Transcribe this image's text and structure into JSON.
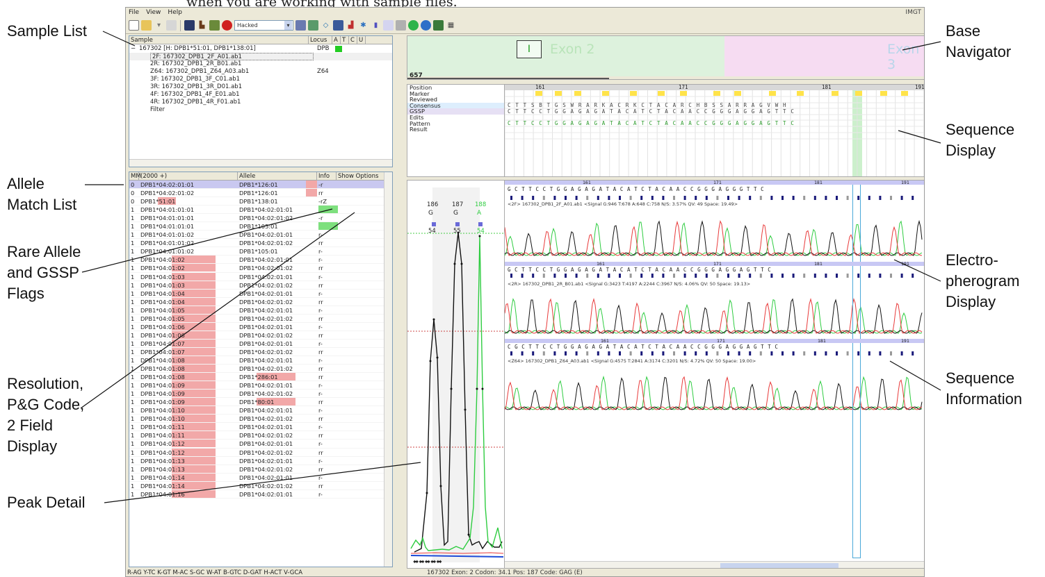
{
  "caption_top": "when you are working with sample files.",
  "callouts": {
    "sample_list": [
      "Sample List"
    ],
    "allele_match": [
      "Allele",
      "Match List"
    ],
    "rare_allele": [
      "Rare Allele",
      "and GSSP",
      "Flags"
    ],
    "resolution": [
      "Resolution,",
      "P&G Code,",
      "2 Field",
      "Display"
    ],
    "peak_detail": [
      "Peak Detail"
    ],
    "base_navigator": [
      "Base",
      "Navigator"
    ],
    "sequence_display": [
      "Sequence",
      "Display"
    ],
    "electro": [
      "Electro-",
      "pherogram",
      "Display"
    ],
    "sequence_info": [
      "Sequence",
      "Information"
    ]
  },
  "menu": {
    "items": [
      "File",
      "View",
      "Help"
    ],
    "right_tag": "IMGT"
  },
  "toolbar": {
    "combo_value": "Hacked"
  },
  "sample_panel": {
    "header": {
      "sample": "Sample",
      "locus": "Locus",
      "cols": [
        "A",
        "T",
        "C",
        "U"
      ]
    },
    "rows": [
      {
        "name": "167302 [H: DPB1*51:01, DPB1*138:01]",
        "locus": "DPB"
      },
      {
        "name": "2F: 167302_DPB1_2F_A01.ab1",
        "locus": ""
      },
      {
        "name": "2R: 167302_DPB1_2R_B01.ab1",
        "locus": ""
      },
      {
        "name": "Z64: 167302_DPB1_Z64_A03.ab1",
        "locus": "Z64"
      },
      {
        "name": "3F: 167302_DPB1_3F_C01.ab1",
        "locus": ""
      },
      {
        "name": "3R: 167302_DPB1_3R_D01.ab1",
        "locus": ""
      },
      {
        "name": "4F: 167302_DPB1_4F_E01.ab1",
        "locus": ""
      },
      {
        "name": "4R: 167302_DPB1_4R_F01.ab1",
        "locus": ""
      },
      {
        "name": "Filter",
        "locus": ""
      }
    ]
  },
  "allele_panel": {
    "header": {
      "mm": "MM",
      "col1": "(2000 +)",
      "col2": "Allele",
      "info": "Info",
      "options": "Show Options"
    },
    "rows": [
      {
        "mm": "0",
        "a1": "DPB1*04:02:01:01",
        "a2": "DPB1*126:01",
        "info": "-r"
      },
      {
        "mm": "0",
        "a1": "DPB1*04:02:01:02",
        "a2": "DPB1*126:01",
        "info": "rr"
      },
      {
        "mm": "0",
        "a1": "DPB1*51:01",
        "a2": "DPB1*138:01",
        "info": "-rZ"
      },
      {
        "mm": "1",
        "a1": "DPB1*04:01:01:01",
        "a2": "DPB1*04:02:01:01",
        "info": ""
      },
      {
        "mm": "1",
        "a1": "DPB1*04:01:01:01",
        "a2": "DPB1*04:02:01:02",
        "info": "-r"
      },
      {
        "mm": "1",
        "a1": "DPB1*04:01:01:01",
        "a2": "DPB1*105:01",
        "info": ""
      },
      {
        "mm": "1",
        "a1": "DPB1*04:01:01:02",
        "a2": "DPB1*04:02:01:01",
        "info": "r-"
      },
      {
        "mm": "1",
        "a1": "DPB1*04:01:01:02",
        "a2": "DPB1*04:02:01:02",
        "info": "rr"
      },
      {
        "mm": "1",
        "a1": "DPB1*04:01:01:02",
        "a2": "DPB1*105:01",
        "info": "r-"
      },
      {
        "mm": "1",
        "a1": "DPB1*04:01:02",
        "a2": "DPB1*04:02:01:01",
        "info": "r-"
      },
      {
        "mm": "1",
        "a1": "DPB1*04:01:02",
        "a2": "DPB1*04:02:01:02",
        "info": "rr"
      },
      {
        "mm": "1",
        "a1": "DPB1*04:01:03",
        "a2": "DPB1*04:02:01:01",
        "info": "r-"
      },
      {
        "mm": "1",
        "a1": "DPB1*04:01:03",
        "a2": "DPB1*04:02:01:02",
        "info": "rr"
      },
      {
        "mm": "1",
        "a1": "DPB1*04:01:04",
        "a2": "DPB1*04:02:01:01",
        "info": "r-"
      },
      {
        "mm": "1",
        "a1": "DPB1*04:01:04",
        "a2": "DPB1*04:02:01:02",
        "info": "rr"
      },
      {
        "mm": "1",
        "a1": "DPB1*04:01:05",
        "a2": "DPB1*04:02:01:01",
        "info": "r-"
      },
      {
        "mm": "1",
        "a1": "DPB1*04:01:05",
        "a2": "DPB1*04:02:01:02",
        "info": "rr"
      },
      {
        "mm": "1",
        "a1": "DPB1*04:01:06",
        "a2": "DPB1*04:02:01:01",
        "info": "r-"
      },
      {
        "mm": "1",
        "a1": "DPB1*04:01:06",
        "a2": "DPB1*04:02:01:02",
        "info": "rr"
      },
      {
        "mm": "1",
        "a1": "DPB1*04:01:07",
        "a2": "DPB1*04:02:01:01",
        "info": "r-"
      },
      {
        "mm": "1",
        "a1": "DPB1*04:01:07",
        "a2": "DPB1*04:02:01:02",
        "info": "rr"
      },
      {
        "mm": "1",
        "a1": "DPB1*04:01:08",
        "a2": "DPB1*04:02:01:01",
        "info": "r-"
      },
      {
        "mm": "1",
        "a1": "DPB1*04:01:08",
        "a2": "DPB1*04:02:01:02",
        "info": "rr"
      },
      {
        "mm": "1",
        "a1": "DPB1*04:01:08",
        "a2": "DPB1*286:01",
        "info": "rr"
      },
      {
        "mm": "1",
        "a1": "DPB1*04:01:09",
        "a2": "DPB1*04:02:01:01",
        "info": "r-"
      },
      {
        "mm": "1",
        "a1": "DPB1*04:01:09",
        "a2": "DPB1*04:02:01:02",
        "info": "r-"
      },
      {
        "mm": "1",
        "a1": "DPB1*04:01:09",
        "a2": "DPB1*80:01",
        "info": "rr"
      },
      {
        "mm": "1",
        "a1": "DPB1*04:01:10",
        "a2": "DPB1*04:02:01:01",
        "info": "r-"
      },
      {
        "mm": "1",
        "a1": "DPB1*04:01:10",
        "a2": "DPB1*04:02:01:02",
        "info": "rr"
      },
      {
        "mm": "1",
        "a1": "DPB1*04:01:11",
        "a2": "DPB1*04:02:01:01",
        "info": "r-"
      },
      {
        "mm": "1",
        "a1": "DPB1*04:01:11",
        "a2": "DPB1*04:02:01:02",
        "info": "rr"
      },
      {
        "mm": "1",
        "a1": "DPB1*04:01:12",
        "a2": "DPB1*04:02:01:01",
        "info": "r-"
      },
      {
        "mm": "1",
        "a1": "DPB1*04:01:12",
        "a2": "DPB1*04:02:01:02",
        "info": "rr"
      },
      {
        "mm": "1",
        "a1": "DPB1*04:01:13",
        "a2": "DPB1*04:02:01:01",
        "info": "r-"
      },
      {
        "mm": "1",
        "a1": "DPB1*04:01:13",
        "a2": "DPB1*04:02:01:02",
        "info": "rr"
      },
      {
        "mm": "1",
        "a1": "DPB1*04:01:14",
        "a2": "DPB1*04:02:01:01",
        "info": "r-"
      },
      {
        "mm": "1",
        "a1": "DPB1*04:01:14",
        "a2": "DPB1*04:02:01:02",
        "info": "rr"
      },
      {
        "mm": "1",
        "a1": "DPB1*04:01:16",
        "a2": "DPB1*04:02:01:01",
        "info": "r-"
      }
    ]
  },
  "status_flags": "R-AG Y-TC K-GT M-AC S-GC W-AT B-GTC D-GAT H-ACT V-GCA",
  "status_info": "167302  Exon: 2  Codon: 34.1  Pos: 187  Code: GAG (E)",
  "navigator": {
    "box_label": "I",
    "exon_left": "Exon 2",
    "exon_right": "Exon 3",
    "position": "657"
  },
  "sequence_display": {
    "labels": [
      "Position",
      "Marker",
      "Reviewed",
      "Consensus",
      "GSSP",
      "Edits",
      "Pattern",
      "Result"
    ],
    "ticks": [
      "161",
      "171",
      "181",
      "191"
    ],
    "consensus": "CTTSBTGSWRARKACRKCTACARCHBSSARRAGVWH",
    "gssp": "CTTCCTGGAGAGATACATCTACAACCGGGAGGAGTTC",
    "pattern": "CTTCCTGGAGAGATACATCTACAACCGGGAGGAGTTC"
  },
  "peak_detail": {
    "pos_labels": [
      "186",
      "187",
      "188"
    ],
    "bases": [
      "G",
      "G",
      "A"
    ],
    "qualities": [
      "54",
      "55",
      "54"
    ]
  },
  "traces": [
    {
      "ticks": [
        "161",
        "171",
        "181",
        "191"
      ],
      "bases": "GCTTCCTGGAGAGATACATCTACAACCGGGAGGGTTC",
      "info": "<2F> 167302_DPB1_2F_A01.ab1  <Signal G:946 T:678 A:648 C:758 N/S: 3.57% QV: 49 Space: 19.49>"
    },
    {
      "ticks": [
        "161",
        "171",
        "181",
        "191"
      ],
      "bases": "GCTTCCTGGAGAGATACATCTACAACCGGGAGGAGTTC",
      "info": "<2R> 167302_DPB1_2R_B01.ab1  <Signal G:3423 T:4197 A:2244 C:3967 N/S: 4.06% QV: 50 Space: 19.13>"
    },
    {
      "ticks": [
        "161",
        "171",
        "181",
        "191"
      ],
      "bases": "CGCTTCCTGGAGAGATACATCTACAACCGGGAGGAGTTC",
      "info": "<Z64> 167302_DPB1_Z64_A03.ab1  <Signal G:4575 T:2841 A:3174 C:3201 N/S: 4.72% QV: 50 Space: 19.00>"
    }
  ],
  "colors": {
    "pink_highlight": "#f2a8a8",
    "green_flag": "#7ee07e",
    "selection": "#c9c8f0",
    "trace_green": "#2ecc40",
    "trace_red": "#e83a3a",
    "trace_black": "#111111",
    "trace_blue": "#1e4bd8"
  }
}
